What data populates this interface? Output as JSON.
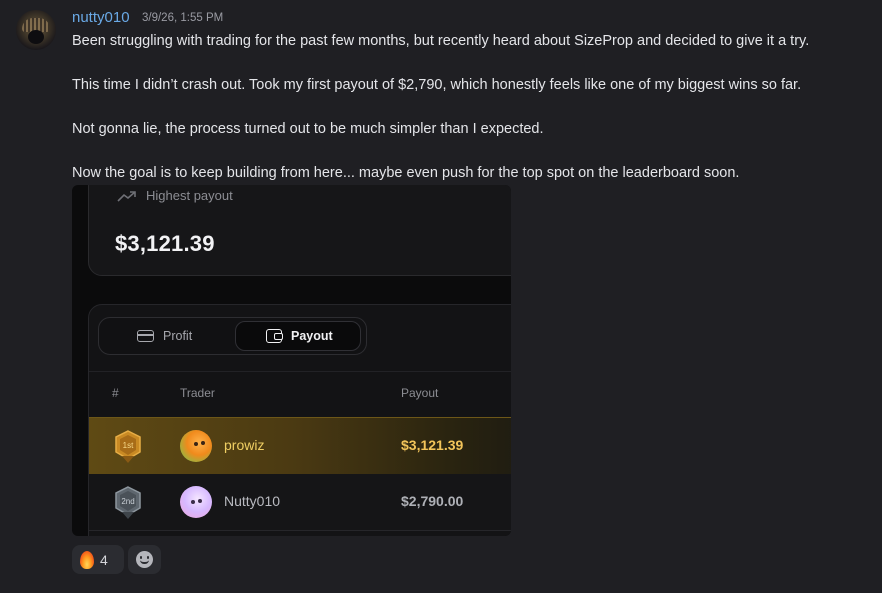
{
  "message": {
    "username": "nutty010",
    "timestamp": "3/9/26, 1:55 PM",
    "lines": [
      "Been struggling with trading for the past few months, but recently heard about SizeProp and decided to give it a try.",
      "This time I didn’t crash out. Took my first payout of $2,790, which honestly feels like one of my biggest wins so far.",
      "Not gonna lie, the process turned out to be much simpler than I expected.",
      "Now the goal is to keep building from here... maybe even push for the top spot on the leaderboard soon."
    ]
  },
  "embed": {
    "highest_payout_label": "Highest payout",
    "highest_payout_value": "$3,121.39",
    "tabs": {
      "profit": "Profit",
      "payout": "Payout",
      "active": "payout"
    },
    "table": {
      "headers": {
        "rank": "#",
        "trader": "Trader",
        "payout": "Payout"
      },
      "rows": [
        {
          "rank": "1st",
          "trader": "prowiz",
          "payout": "$3,121.39"
        },
        {
          "rank": "2nd",
          "trader": "Nutty010",
          "payout": "$2,790.00"
        }
      ]
    }
  },
  "reactions": [
    {
      "icon": "fire-icon",
      "count": "4"
    },
    {
      "icon": "add-reaction-icon"
    }
  ],
  "colors": {
    "username": "#6aa9e6",
    "gold": "#f2c45a",
    "silver": "#aeb0b6",
    "background": "#1f1f23"
  }
}
